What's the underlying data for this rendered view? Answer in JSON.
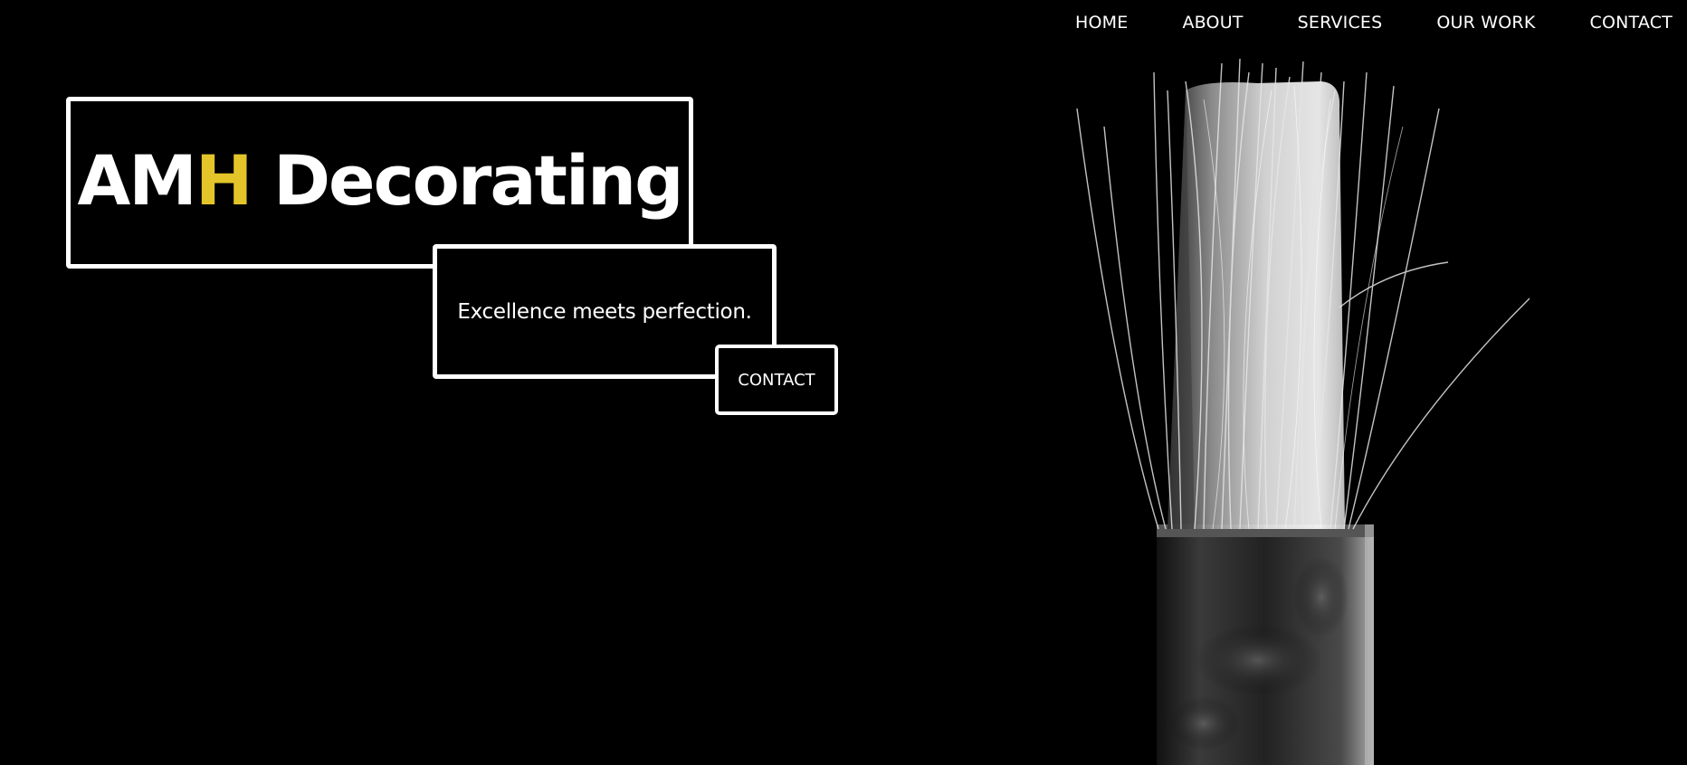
{
  "nav": {
    "items": [
      {
        "label": "HOME"
      },
      {
        "label": "ABOUT"
      },
      {
        "label": "SERVICES"
      },
      {
        "label": "OUR WORK"
      },
      {
        "label": "CONTACT"
      }
    ]
  },
  "hero": {
    "title_part1": "AM",
    "title_accent": "H",
    "title_part2": " Decorating",
    "tagline": "Excellence meets perfection.",
    "cta_label": "CONTACT"
  },
  "colors": {
    "background": "#000000",
    "foreground": "#ffffff",
    "accent": "#e3c52a"
  },
  "icons": {
    "hero_image": "paintbrush-image"
  }
}
